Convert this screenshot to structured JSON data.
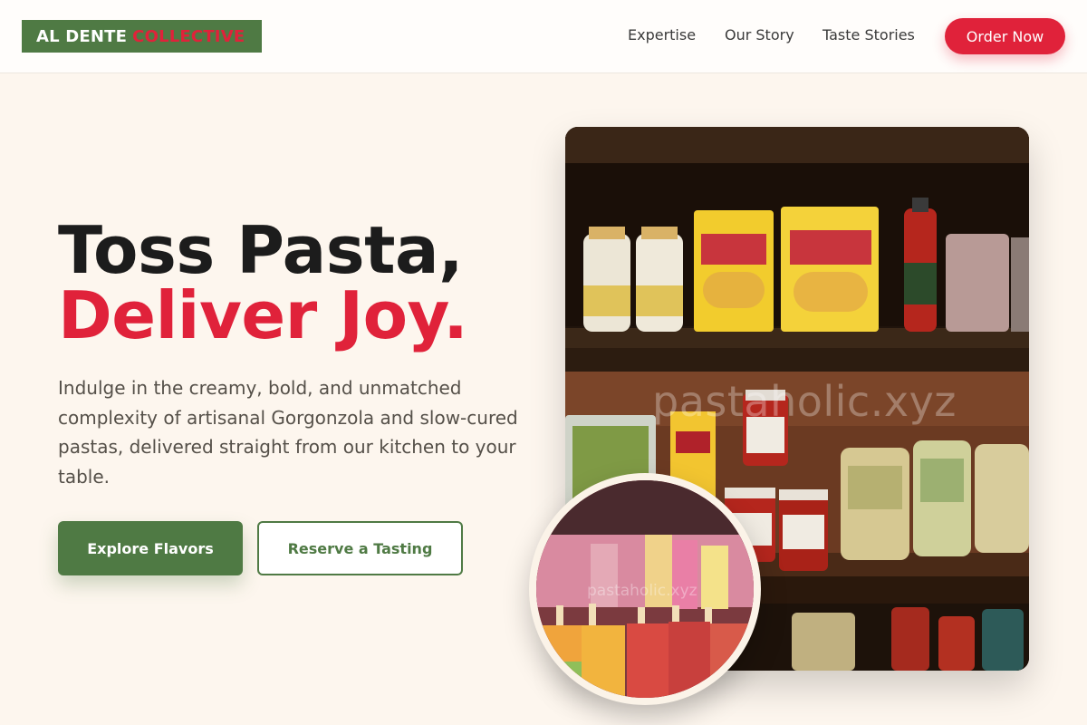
{
  "brand": {
    "name_part1": "AL DENTE",
    "name_part2": "COLLECTIVE"
  },
  "nav": {
    "links": [
      "Expertise",
      "Our Story",
      "Taste Stories"
    ],
    "cta": "Order Now"
  },
  "hero": {
    "headline_line1": "Toss Pasta,",
    "headline_line2": "Deliver Joy.",
    "description": "Indulge in the creamy, bold, and unmatched complexity of artisanal Gorgonzola and slow-cured pastas, delivered straight from our kitchen to your table.",
    "primary_button": "Explore Flavors",
    "secondary_button": "Reserve a Tasting"
  },
  "images": {
    "main_alt": "Pantry shelves stocked with polenta, sauces and pasta",
    "main_watermark": "pastaholic.xyz",
    "inset_alt": "Rows of colorful fruit popsicles",
    "inset_watermark": "pastaholic.xyz"
  },
  "colors": {
    "brand_green": "#4f7a44",
    "accent_red": "#e0223a",
    "background_cream": "#fdf6ee"
  }
}
